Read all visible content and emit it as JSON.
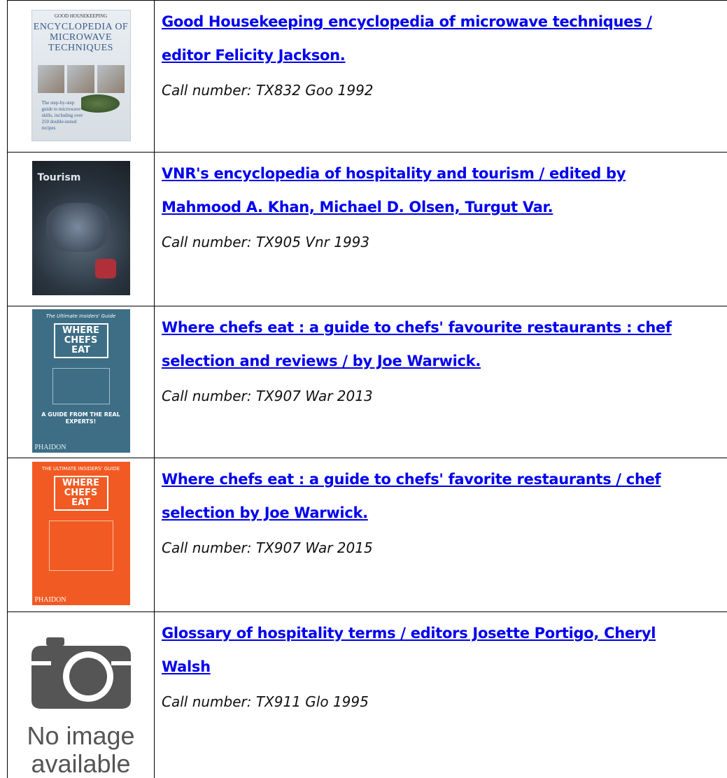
{
  "books": [
    {
      "title": "Good Housekeeping encyclopedia of microwave techniques / editor Felicity Jackson.",
      "title_line1": "Good Housekeeping encyclopedia of microwave techniques /",
      "title_line2": "editor Felicity Jackson.",
      "call_number": "Call number: TX832 Goo 1992",
      "cover": {
        "publisher": "GOOD HOUSEKEEPING",
        "title": "ENCYCLOPEDIA OF MICROWAVE TECHNIQUES",
        "blurb": "The step-by-step guide to microwave skills, including over 250 double-tested recipes"
      }
    },
    {
      "title": "VNR's encyclopedia of hospitality and tourism / edited by Mahmood A. Khan, Michael D. Olsen, Turgut Var.",
      "title_line1": "VNR's encyclopedia of hospitality and tourism / edited by",
      "title_line2": "Mahmood A. Khan, Michael D. Olsen, Turgut Var.",
      "call_number": "Call number: TX905 Vnr 1993",
      "cover": {
        "title": "Tourism"
      }
    },
    {
      "title": "Where chefs eat : a guide to chefs' favourite restaurants : chef selection and reviews / by Joe Warwick.",
      "title_line1": "Where chefs eat : a guide to chefs' favourite restaurants : chef",
      "title_line2": "selection and reviews / by Joe Warwick.",
      "call_number": "Call number: TX907 War 2013",
      "cover": {
        "header": "The Ultimate Insiders' Guide",
        "title": "WHERE CHEFS EAT",
        "footer": "A GUIDE FROM THE REAL EXPERTS!",
        "publisher": "PHAIDON"
      }
    },
    {
      "title": "Where chefs eat : a guide to chefs' favorite restaurants / chef selection by Joe Warwick.",
      "title_line1": "Where chefs eat : a guide to chefs' favorite restaurants / chef",
      "title_line2": "selection by Joe Warwick.",
      "call_number": "Call number: TX907 War 2015",
      "cover": {
        "header": "THE ULTIMATE INSIDERS' GUIDE",
        "title": "WHERE CHEFS EAT",
        "publisher": "PHAIDON"
      }
    },
    {
      "title": "Glossary of hospitality terms / editors Josette Portigo, Cheryl Walsh",
      "title_line1": "Glossary of hospitality terms / editors Josette Portigo, Cheryl",
      "title_line2": "Walsh",
      "call_number": "Call number: TX911 Glo 1995",
      "cover": {
        "placeholder_line1": "No image",
        "placeholder_line2": "available"
      }
    }
  ],
  "colors": {
    "link": "#0000ee",
    "border": "#000000"
  },
  "icons": {
    "no_image": "camera-icon"
  }
}
